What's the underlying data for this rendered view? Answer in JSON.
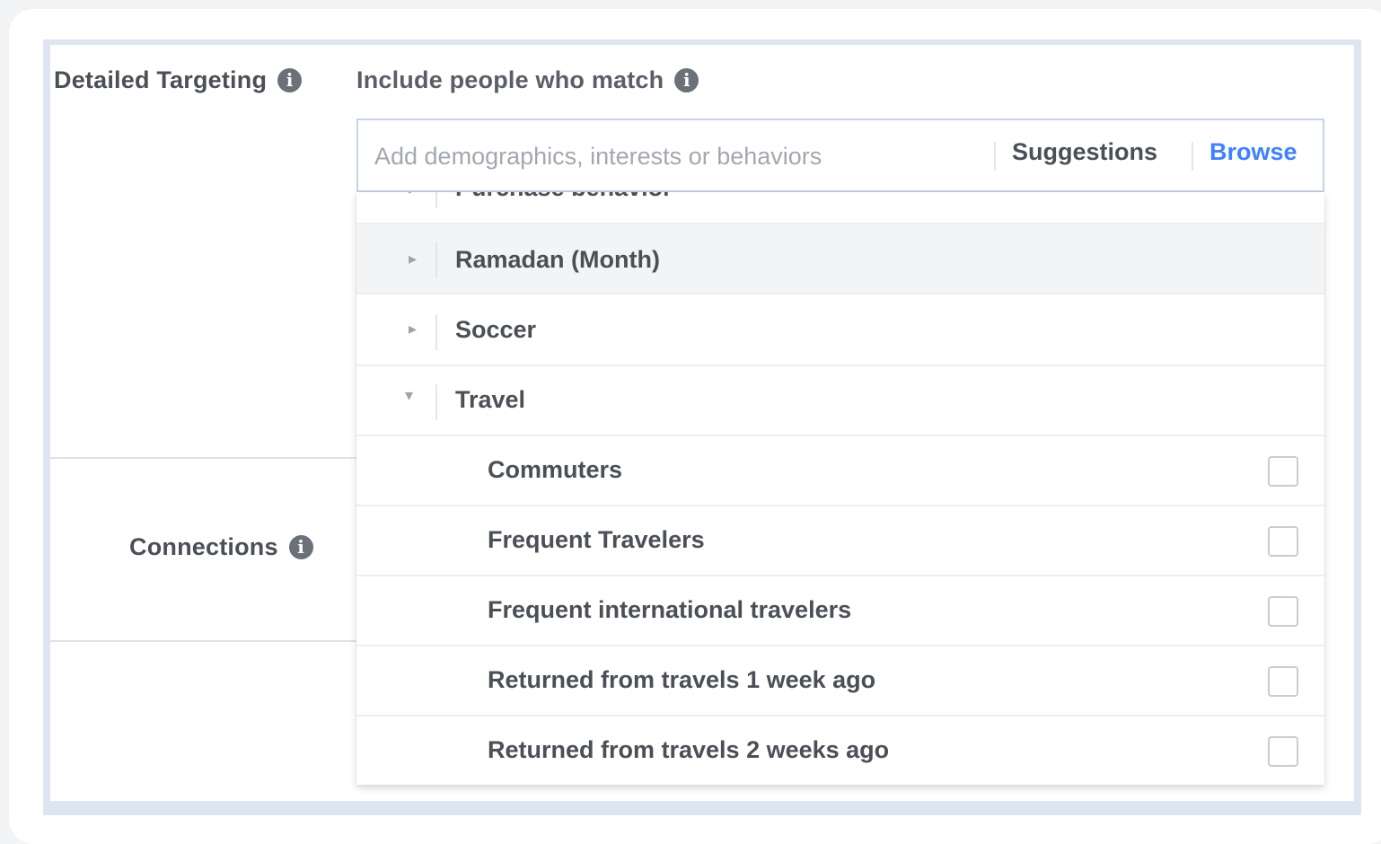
{
  "detailed_targeting": {
    "label": "Detailed Targeting",
    "info_glyph": "i"
  },
  "include": {
    "label": "Include people who match",
    "info_glyph": "i"
  },
  "connections": {
    "label": "Connections",
    "info_glyph": "i"
  },
  "search": {
    "placeholder": "Add demographics, interests or behaviors",
    "value": "",
    "suggestions_label": "Suggestions",
    "browse_label": "Browse",
    "browse_color": "#4080ff"
  },
  "categories": [
    {
      "label": "Purchase behavior",
      "expanded": false,
      "partially_visible": true
    },
    {
      "label": "Ramadan (Month)",
      "expanded": false,
      "hovered": true
    },
    {
      "label": "Soccer",
      "expanded": false
    },
    {
      "label": "Travel",
      "expanded": true
    }
  ],
  "travel_items": [
    {
      "label": "Commuters",
      "checked": false
    },
    {
      "label": "Frequent Travelers",
      "checked": false
    },
    {
      "label": "Frequent international travelers",
      "checked": false
    },
    {
      "label": "Returned from travels 1 week ago",
      "checked": false
    },
    {
      "label": "Returned from travels 2 weeks ago",
      "checked": false
    }
  ],
  "icons": {
    "info": "info-icon",
    "caret_right": "caret-right-icon",
    "caret_down": "caret-down-icon"
  }
}
